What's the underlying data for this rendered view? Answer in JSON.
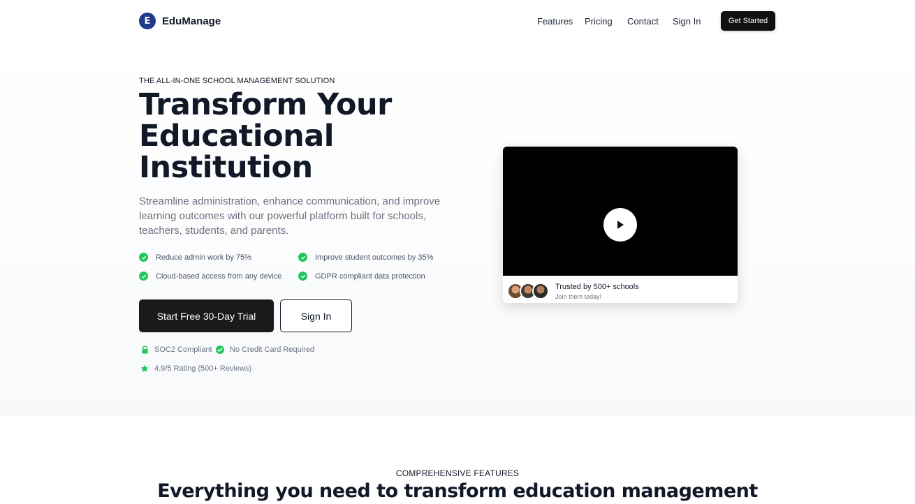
{
  "nav": {
    "brand_initial": "E",
    "brand_name": "EduManage",
    "links": [
      "Features",
      "Pricing",
      "Contact",
      "Sign In"
    ],
    "cta_label": "Get Started"
  },
  "hero": {
    "eyebrow": "THE ALL-IN-ONE SCHOOL MANAGEMENT SOLUTION",
    "headline": "Transform Your Educational Institution",
    "subtitle": "Streamline administration, enhance communication, and improve learning outcomes with our powerful platform built for schools, teachers, students, and parents.",
    "benefits": [
      "Reduce admin work by 75%",
      "Improve student outcomes by 35%",
      "Cloud-based access from any device",
      "GDPR compliant data protection"
    ],
    "primary_button": "Start Free 30-Day Trial",
    "secondary_button": "Sign In",
    "trust": [
      {
        "icon": "lock-icon",
        "label": "SOC2 Compliant"
      },
      {
        "icon": "check-circle-icon",
        "label": "No Credit Card Required"
      },
      {
        "icon": "star-icon",
        "label": "4.9/5 Rating (500+ Reviews)"
      }
    ]
  },
  "video": {
    "trusted_title": "Trusted by 500+ schools",
    "trusted_sub": "Join them today!"
  },
  "features": {
    "eyebrow": "COMPREHENSIVE FEATURES",
    "title": "Everything you need to transform education management"
  },
  "colors": {
    "accent_green": "#22c55e",
    "brand_navy": "#1e3a8a",
    "button_dark": "#1a1a1a"
  }
}
